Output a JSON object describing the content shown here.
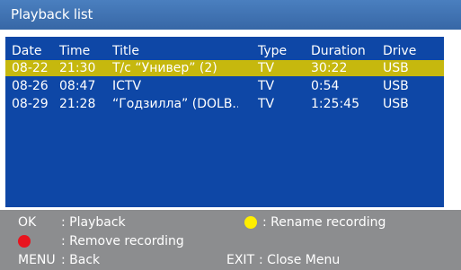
{
  "header": {
    "title": "Playback list"
  },
  "columns": {
    "date": "Date",
    "time": "Time",
    "title": "Title",
    "type": "Type",
    "duration": "Duration",
    "drive": "Drive"
  },
  "rows": [
    {
      "date": "08-22",
      "time": "21:30",
      "title": "Т/с “Универ” (2)",
      "type": "TV",
      "duration": "30:22",
      "drive": "USB"
    },
    {
      "date": "08-26",
      "time": "08:47",
      "title": "ICTV",
      "type": "TV",
      "duration": "0:54",
      "drive": "USB"
    },
    {
      "date": "08-29",
      "time": "21:28",
      "title": "“Годзилла” (DOLB...",
      "type": "TV",
      "duration": "1:25:45",
      "drive": "USB"
    }
  ],
  "selected_row": 0,
  "footer": {
    "ok_key": "OK",
    "ok_action": ": Playback",
    "yellow_action": ": Rename recording",
    "red_action": ": Remove recording",
    "menu_key": "MENU",
    "menu_action": ": Back",
    "exit_key": "EXIT",
    "exit_action": ": Close Menu"
  },
  "colors": {
    "panel": "#0e47a6",
    "header": "#4272b3",
    "selected": "#c6b80e",
    "footer": "#8c8d8f",
    "yellow_button": "#ffee00",
    "red_button": "#e8141e"
  },
  "icons": {
    "yellow": "yellow-button-icon",
    "red": "red-button-icon"
  }
}
